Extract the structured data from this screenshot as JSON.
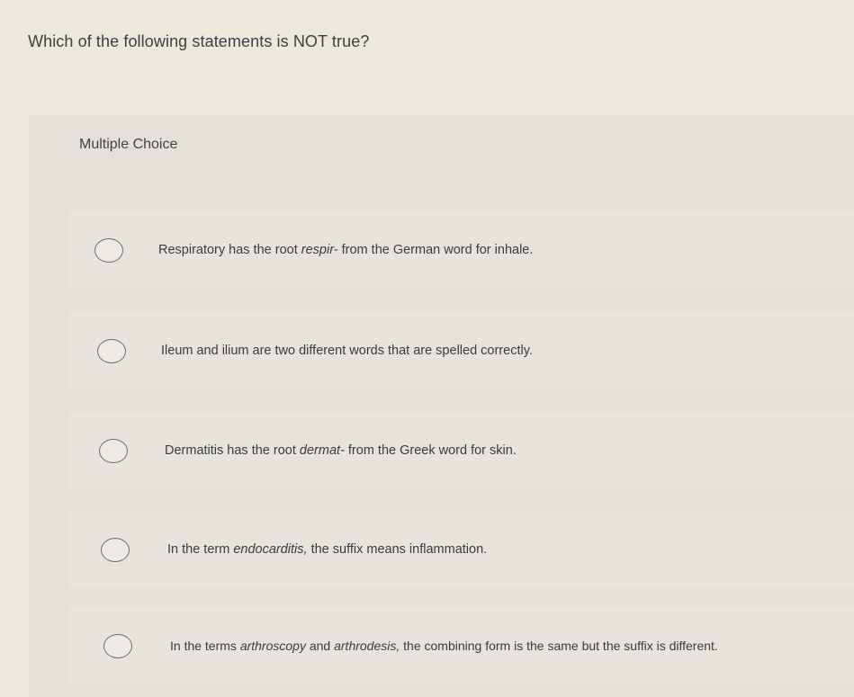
{
  "question": {
    "text": "Which of the following statements is NOT true?"
  },
  "panel": {
    "label": "Multiple Choice"
  },
  "choices": [
    {
      "before": "Respiratory has the root ",
      "italic": "respir-",
      "after": " from the German word for inhale."
    },
    {
      "before": "Ileum and ilium are two different words that are spelled correctly.",
      "italic": "",
      "after": ""
    },
    {
      "before": "Dermatitis has the root ",
      "italic": "dermat-",
      "after": " from the Greek word for skin."
    },
    {
      "before": "In the term ",
      "italic": "endocarditis,",
      "after": " the suffix means inflammation."
    },
    {
      "before": "In the terms ",
      "italic": "arthroscopy",
      "middle": " and ",
      "italic2": "arthrodesis,",
      "after": " the combining form is the same but the suffix is different."
    }
  ]
}
